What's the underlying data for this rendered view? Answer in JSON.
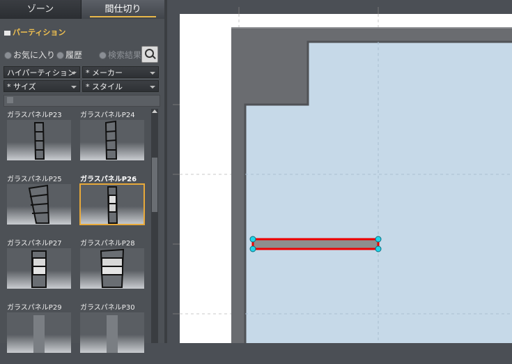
{
  "tabs": {
    "zone": "ゾーン",
    "partition": "間仕切り"
  },
  "category": "パーティション",
  "history": {
    "favorites": "お気に入り",
    "history": "履歴",
    "search_results": "検索結果"
  },
  "filters": {
    "partition_type": "ハイパーティション",
    "maker": "* メーカー",
    "size": "* サイズ",
    "style": "* スタイル"
  },
  "items": [
    {
      "label": "ガラスパネルP23"
    },
    {
      "label": "ガラスパネルP24"
    },
    {
      "label": "ガラスパネルP25"
    },
    {
      "label": "ガラスパネルP26",
      "selected": true
    },
    {
      "label": "ガラスパネルP27"
    },
    {
      "label": "ガラスパネルP28"
    },
    {
      "label": "ガラスパネルP29"
    },
    {
      "label": "ガラスパネルP30"
    }
  ],
  "colors": {
    "accent": "#e8a93a",
    "floor": "#c6d9e8",
    "wall": "#6a6c70",
    "selection": "#ee0000",
    "handle": "#22d4e8"
  },
  "icons": {
    "folder": "folder-icon",
    "search": "magnifier-icon"
  }
}
